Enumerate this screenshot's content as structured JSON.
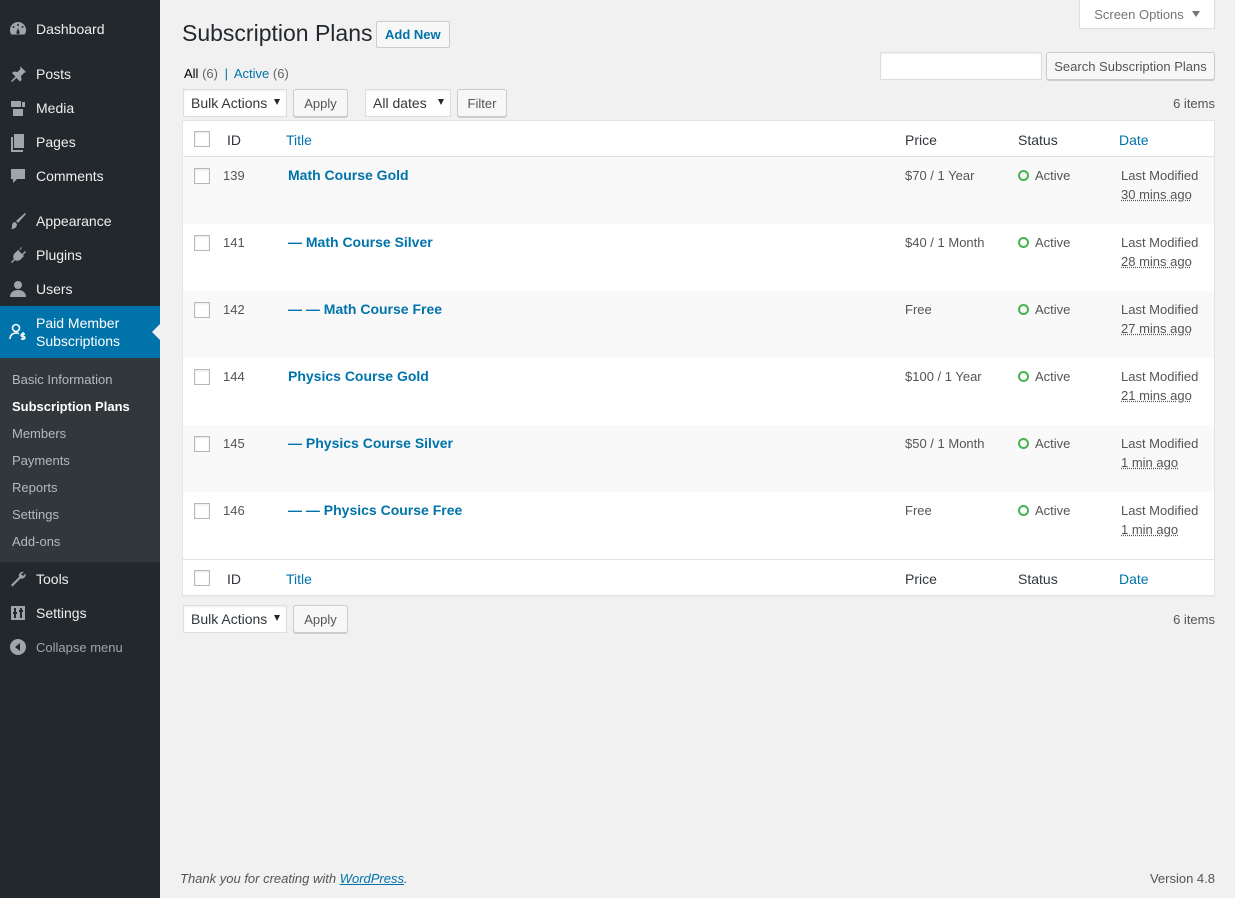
{
  "sidebar": {
    "menu": [
      {
        "label": "Dashboard",
        "icon": "dashboard-icon"
      },
      {
        "label": "Posts",
        "icon": "pin-icon"
      },
      {
        "label": "Media",
        "icon": "media-icon"
      },
      {
        "label": "Pages",
        "icon": "pages-icon"
      },
      {
        "label": "Comments",
        "icon": "comment-icon"
      },
      {
        "label": "Appearance",
        "icon": "paintbrush-icon"
      },
      {
        "label": "Plugins",
        "icon": "plugin-icon"
      },
      {
        "label": "Users",
        "icon": "user-icon"
      }
    ],
    "current": {
      "label_line1": "Paid Member",
      "label_line2": "Subscriptions",
      "icon": "member-dollar-icon"
    },
    "submenu": [
      "Basic Information",
      "Subscription Plans",
      "Members",
      "Payments",
      "Reports",
      "Settings",
      "Add-ons"
    ],
    "menu_after": [
      {
        "label": "Tools",
        "icon": "wrench-icon"
      },
      {
        "label": "Settings",
        "icon": "sliders-icon"
      }
    ],
    "collapse": "Collapse menu"
  },
  "screen_options": "Screen Options",
  "page_title": "Subscription Plans",
  "add_new": "Add New",
  "filters": {
    "all_label": "All",
    "all_count": "(6)",
    "sep": "|",
    "active_label": "Active",
    "active_count": "(6)"
  },
  "search": {
    "value": "",
    "button": "Search Subscription Plans"
  },
  "bulk_actions": {
    "selected": "Bulk Actions",
    "apply": "Apply"
  },
  "dates": {
    "selected": "All dates",
    "filter": "Filter"
  },
  "items_count": "6 items",
  "columns": {
    "id": "ID",
    "title": "Title",
    "price": "Price",
    "status": "Status",
    "date": "Date"
  },
  "rows": [
    {
      "id": "139",
      "title": "Math Course Gold",
      "price": "$70 / 1 Year",
      "status": "Active",
      "date_label": "Last Modified",
      "date_ago": "30 mins ago"
    },
    {
      "id": "141",
      "title": "— Math Course Silver",
      "price": "$40 / 1 Month",
      "status": "Active",
      "date_label": "Last Modified",
      "date_ago": "28 mins ago"
    },
    {
      "id": "142",
      "title": "— — Math Course Free",
      "price": "Free",
      "status": "Active",
      "date_label": "Last Modified",
      "date_ago": "27 mins ago"
    },
    {
      "id": "144",
      "title": "Physics Course Gold",
      "price": "$100 / 1 Year",
      "status": "Active",
      "date_label": "Last Modified",
      "date_ago": "21 mins ago"
    },
    {
      "id": "145",
      "title": "— Physics Course Silver",
      "price": "$50 / 1 Month",
      "status": "Active",
      "date_label": "Last Modified",
      "date_ago": "1 min ago"
    },
    {
      "id": "146",
      "title": "— — Physics Course Free",
      "price": "Free",
      "status": "Active",
      "date_label": "Last Modified",
      "date_ago": "1 min ago"
    }
  ],
  "footer": {
    "thanks_prefix": "Thank you for creating with ",
    "wp_link": "WordPress",
    "thanks_suffix": ".",
    "version": "Version 4.8"
  },
  "colors": {
    "sidebar": "#23282d",
    "submenu": "#32373c",
    "accent": "#0073aa",
    "status_active": "#46b450"
  }
}
